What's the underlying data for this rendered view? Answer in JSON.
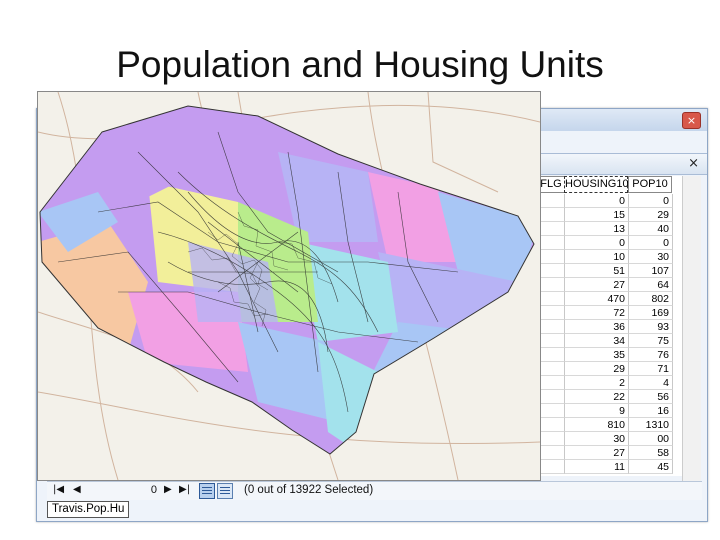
{
  "slide": {
    "title": "Population and Housing Units"
  },
  "table_window": {
    "columns": [
      "FLG",
      "HOUSING10",
      "POP10"
    ],
    "rows": [
      [
        "",
        "0",
        "0"
      ],
      [
        "",
        "15",
        "29"
      ],
      [
        "",
        "13",
        "40"
      ],
      [
        "",
        "0",
        "0"
      ],
      [
        "",
        "10",
        "30"
      ],
      [
        "",
        "51",
        "107"
      ],
      [
        "",
        "27",
        "64"
      ],
      [
        "",
        "470",
        "802"
      ],
      [
        "",
        "72",
        "169"
      ],
      [
        "",
        "36",
        "93"
      ],
      [
        "",
        "34",
        "75"
      ],
      [
        "",
        "35",
        "76"
      ],
      [
        "",
        "29",
        "71"
      ],
      [
        "",
        "2",
        "4"
      ],
      [
        "",
        "22",
        "56"
      ],
      [
        "",
        "9",
        "16"
      ],
      [
        "",
        "810",
        "1310"
      ],
      [
        "",
        "30",
        "00"
      ],
      [
        "",
        "27",
        "58"
      ],
      [
        "",
        "11",
        "45"
      ]
    ],
    "current_record": "0",
    "selection_status": "(0 out of 13922 Selected)",
    "tab_label": "Travis.Pop.Hu",
    "icons": {
      "close": "close-icon",
      "first": "first-record-icon",
      "prev": "previous-record-icon",
      "next": "next-record-icon",
      "last": "last-record-icon",
      "show_all": "show-all-records-icon",
      "show_selected": "show-selected-records-icon"
    },
    "nav_glyphs": {
      "first": "|◀",
      "prev": "◀",
      "next": "▶",
      "last": "▶|",
      "close": "×"
    }
  },
  "map": {
    "description_free": true,
    "colors": {
      "base_map": "#f3f1ea",
      "roads": "#c9a58c",
      "tract_lines": "#2a2a2a",
      "purple": "#c49cf0",
      "lavender": "#b7b3f5",
      "blue": "#a8c6f5",
      "green": "#b9ec8c",
      "pink": "#f2a0e4",
      "peach": "#f7c8a2",
      "cyan": "#a3e2ec",
      "yellow": "#f2ef9a"
    }
  }
}
